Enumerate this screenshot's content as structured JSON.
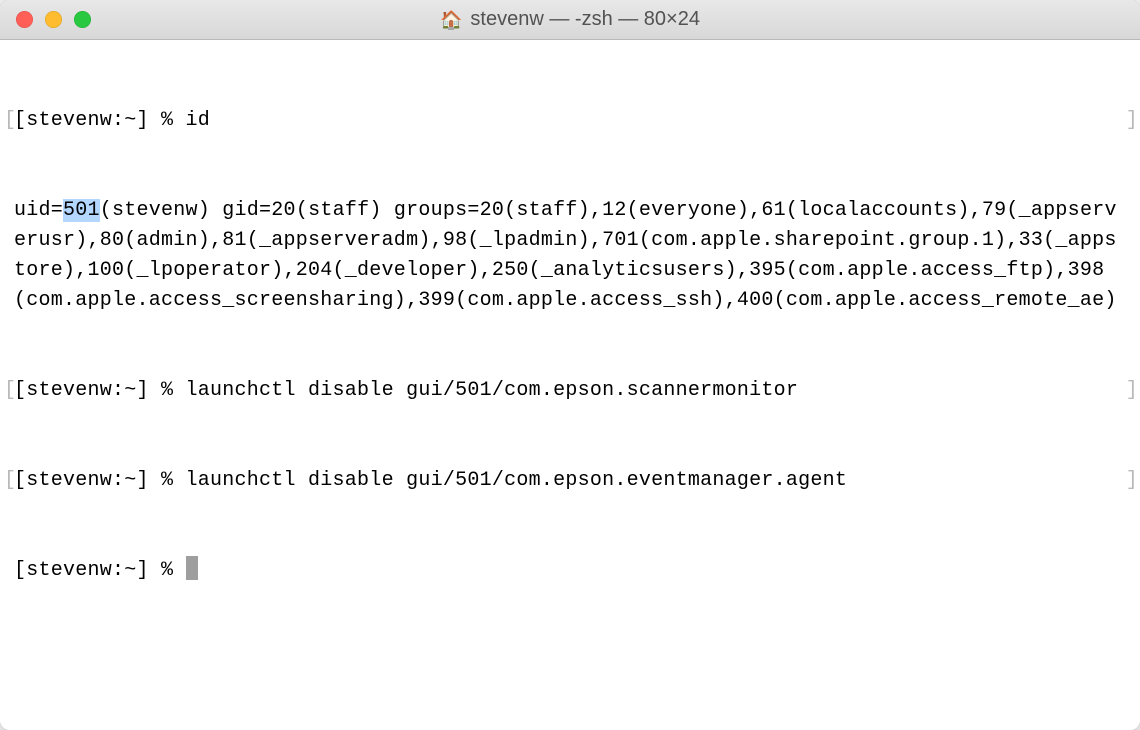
{
  "titlebar": {
    "icon": "🏠",
    "title": "stevenw — -zsh — 80×24"
  },
  "traffic_lights": {
    "close": "#ff5f57",
    "minimize": "#febc2e",
    "zoom": "#28c840"
  },
  "prompt": {
    "prefix": "[stevenw:",
    "path": "~",
    "suffix": "] % "
  },
  "lines": [
    {
      "type": "prompt",
      "prompt": "[stevenw:~] % ",
      "command": "id",
      "brackets": true
    },
    {
      "type": "output",
      "text_pre": "uid=",
      "highlighted": "501",
      "text_post": "(stevenw) gid=20(staff) groups=20(staff),12(everyone),61(localaccounts),79(_appserverusr),80(admin),81(_appserveradm),98(_lpadmin),701(com.apple.sharepoint.group.1),33(_appstore),100(_lpoperator),204(_developer),250(_analyticsusers),395(com.apple.access_ftp),398(com.apple.access_screensharing),399(com.apple.access_ssh),400(com.apple.access_remote_ae)"
    },
    {
      "type": "prompt",
      "prompt": "[stevenw:~] % ",
      "command": "launchctl disable gui/501/com.epson.scannermonitor",
      "brackets": true
    },
    {
      "type": "prompt",
      "prompt": "[stevenw:~] % ",
      "command": "launchctl disable gui/501/com.epson.eventmanager.agent",
      "brackets": true
    },
    {
      "type": "prompt",
      "prompt": "[stevenw:~] % ",
      "command": "",
      "cursor": true,
      "brackets": false
    }
  ],
  "terminal": {
    "cols": 80,
    "rows": 24,
    "shell": "-zsh"
  }
}
